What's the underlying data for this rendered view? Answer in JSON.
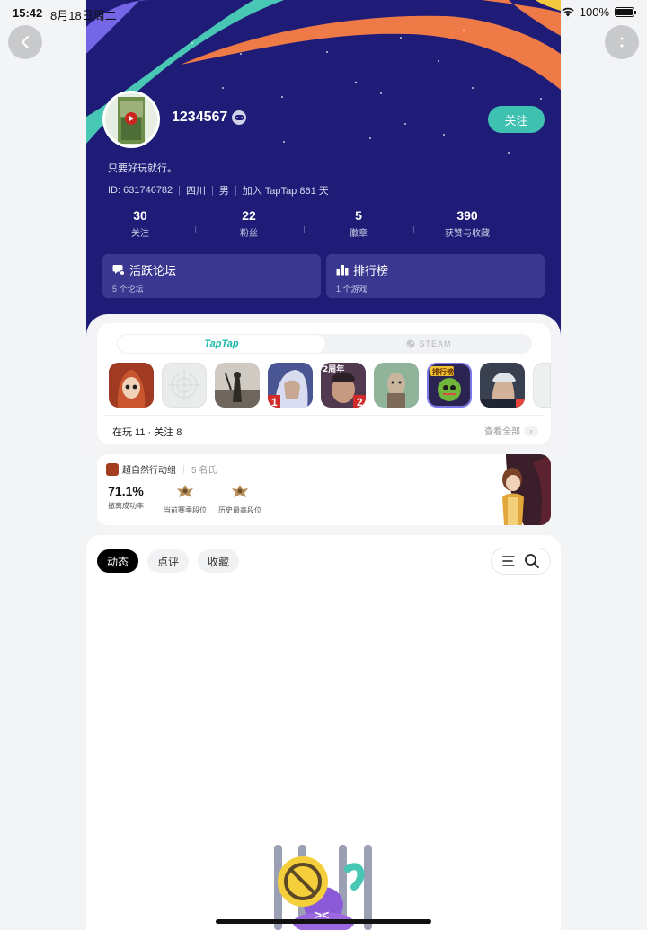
{
  "status_bar": {
    "time": "15:42",
    "date": "8月18日周二",
    "battery": "100%"
  },
  "profile": {
    "username": "1234567",
    "follow_label": "关注",
    "bio": "只要好玩就行。",
    "meta": [
      "ID: 631746782",
      "四川",
      "男",
      "加入 TapTap 861 天"
    ]
  },
  "stats": [
    {
      "value": "30",
      "label": "关注"
    },
    {
      "value": "22",
      "label": "粉丝"
    },
    {
      "value": "5",
      "label": "徽章"
    },
    {
      "value": "390",
      "label": "获赞与收藏"
    }
  ],
  "cards": [
    {
      "title": "活跃论坛",
      "subtitle": "5 个论坛",
      "icon": "forum-icon"
    },
    {
      "title": "排行榜",
      "subtitle": "1 个游戏",
      "icon": "ranking-icon"
    }
  ],
  "games": {
    "tabs": [
      "TapTap",
      "STEAM"
    ],
    "active_tab": "TapTap",
    "playing_text": "在玩 11 · 关注 8",
    "see_all": "查看全部",
    "icons": [
      {
        "name": "game-icon-red-hood",
        "color": "#b3452a"
      },
      {
        "name": "game-icon-placeholder",
        "color": "#e9ecea"
      },
      {
        "name": "game-icon-dark-survivor",
        "color": "#5a564f"
      },
      {
        "name": "game-icon-warrior-1",
        "color": "#5d6aa6",
        "badge": "1"
      },
      {
        "name": "game-icon-anniversary-2",
        "color": "#6e4b6a",
        "badge": "2",
        "badge_text": "2周年"
      },
      {
        "name": "game-icon-creature",
        "color": "#7da287"
      },
      {
        "name": "game-icon-ranking",
        "color": "#2f2a57",
        "badge_text": "排行榜"
      },
      {
        "name": "game-icon-soldier",
        "color": "#3c4150"
      },
      {
        "name": "game-icon-partial",
        "color": "#eef0ef"
      }
    ]
  },
  "record": {
    "game_name": "超自然行动组",
    "players": "5 名氏",
    "escape_rate": "71.1%",
    "escape_label": "撤离成功率",
    "season_label": "当前赛季段位",
    "history_label": "历史最高段位"
  },
  "feed": {
    "tabs": [
      "动态",
      "点评",
      "收藏"
    ],
    "active_tab": "动态"
  },
  "colors": {
    "hero_bg": "#1f1c78",
    "accent": "#3ec1b1",
    "taptap": "#18b8a8"
  }
}
